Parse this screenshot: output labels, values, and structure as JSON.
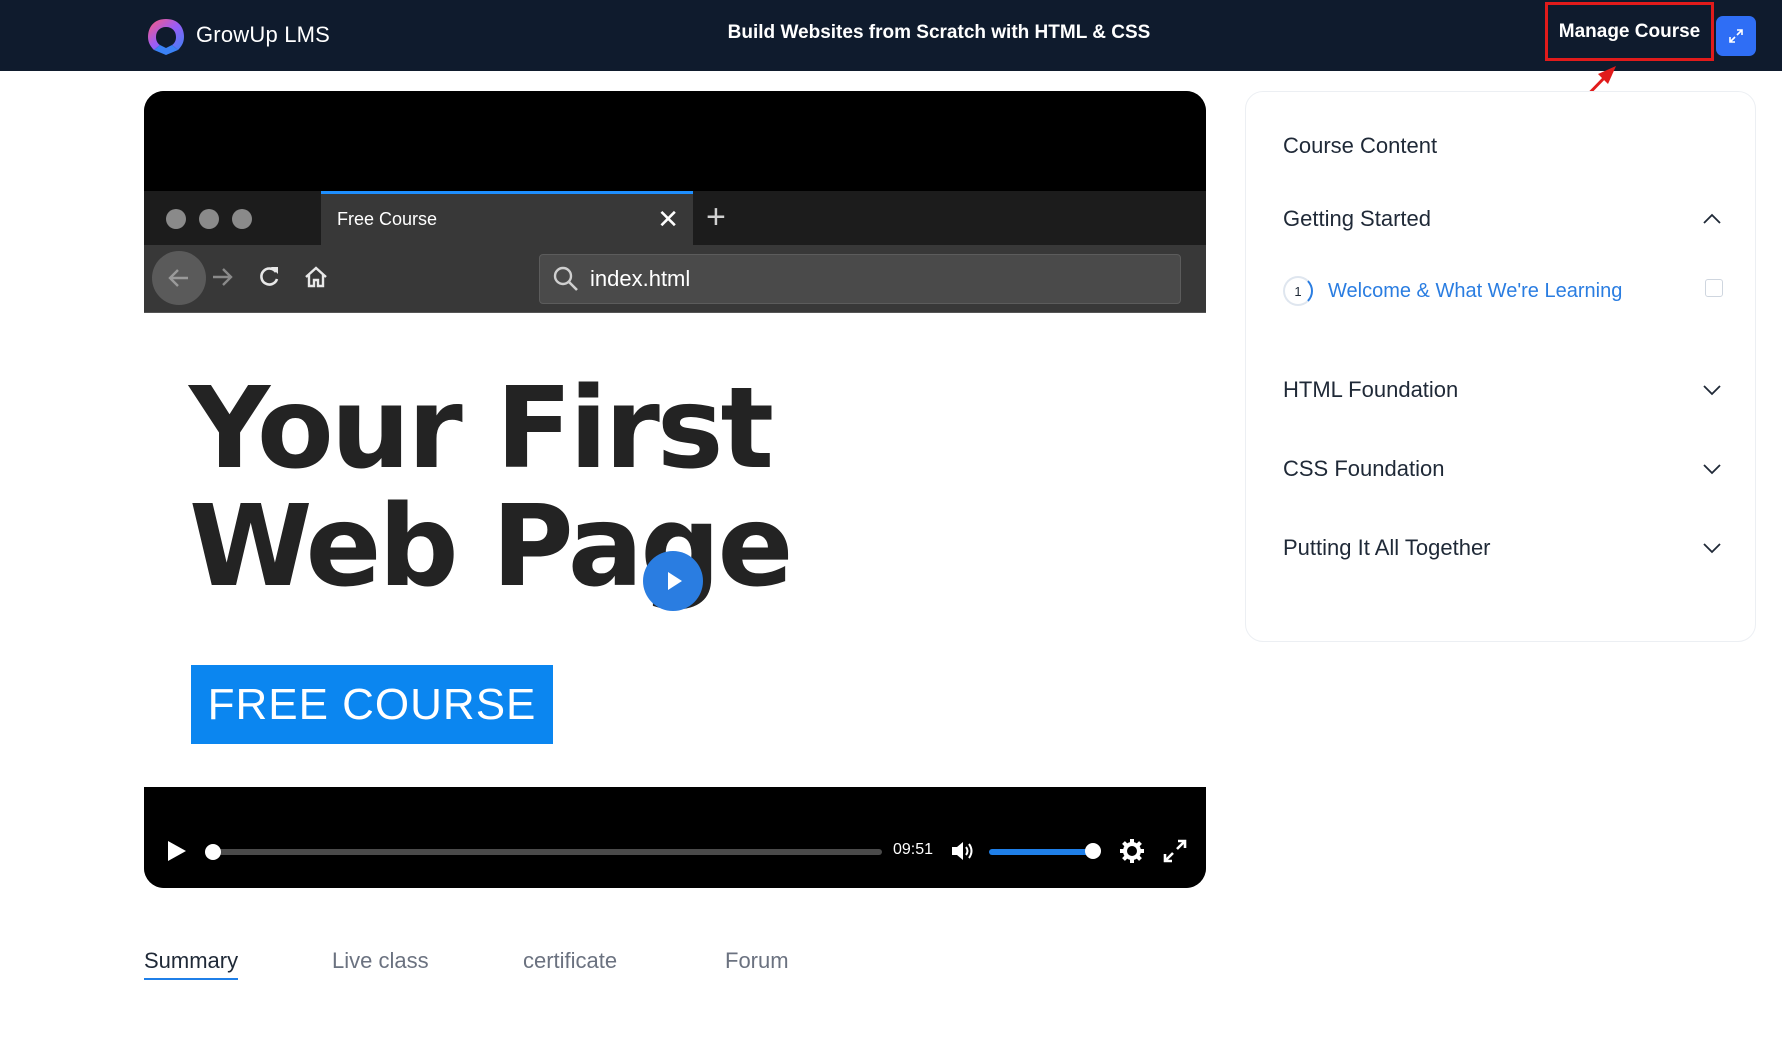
{
  "header": {
    "app_name": "GrowUp LMS",
    "course_title": "Build Websites from Scratch with HTML & CSS",
    "manage_label": "Manage Course",
    "expand_icon": "expand-icon",
    "brand_color": "#0f1b2d",
    "accent_color": "#2f6ef5"
  },
  "video": {
    "browser": {
      "tab_label": "Free Course",
      "url": "index.html"
    },
    "slide": {
      "headline_line1": "Your First",
      "headline_line2": "Web Page",
      "badge": "FREE COURSE"
    },
    "player": {
      "time": "09:51",
      "progress": 0.0,
      "volume": 1.0
    }
  },
  "tabs": [
    {
      "label": "Summary",
      "active": true
    },
    {
      "label": "Live class",
      "active": false
    },
    {
      "label": "certificate",
      "active": false
    },
    {
      "label": "Forum",
      "active": false
    }
  ],
  "sidebar": {
    "title": "Course Content",
    "sections": [
      {
        "label": "Getting Started",
        "expanded": true
      },
      {
        "label": "HTML Foundation",
        "expanded": false
      },
      {
        "label": "CSS Foundation",
        "expanded": false
      },
      {
        "label": "Putting It All Together",
        "expanded": false
      }
    ],
    "lesson": {
      "number": "1",
      "label": "Welcome & What We're Learning"
    }
  }
}
